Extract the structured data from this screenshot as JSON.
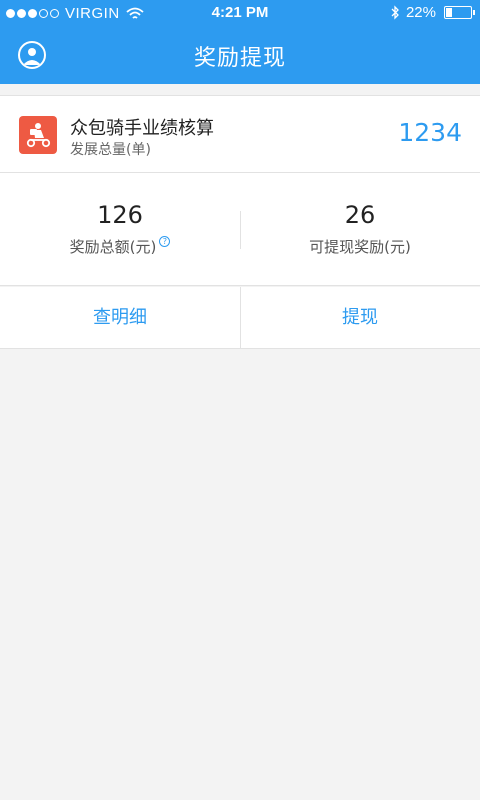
{
  "status_bar": {
    "carrier": "VIRGIN",
    "time": "4:21 PM",
    "battery": "22%",
    "signal_strength_dots_filled": 3,
    "signal_strength_dots_total": 5,
    "icons": [
      "wifi-icon",
      "bluetooth-icon",
      "battery-icon"
    ]
  },
  "nav": {
    "title": "奖励提现",
    "icon": "user-icon"
  },
  "summary": {
    "title": "众包骑手业绩核算",
    "subtitle": "发展总量(单)",
    "count": "1234",
    "icon": "courier-scooter-icon"
  },
  "stats": {
    "total_reward_value": "126",
    "total_reward_label": "奖励总额(元)",
    "withdrawable_value": "26",
    "withdrawable_label": "可提现奖励(元)",
    "help_icon": "question-circle-icon"
  },
  "actions": {
    "details_label": "查明细",
    "withdraw_label": "提现"
  },
  "colors": {
    "primary": "#2d9bf0",
    "brand_red": "#ee5a43",
    "background": "#f3f3f3"
  }
}
